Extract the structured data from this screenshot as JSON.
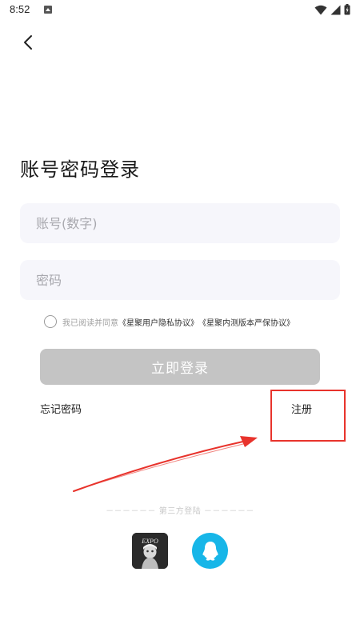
{
  "status_bar": {
    "time": "8:52",
    "icons": [
      "notification-app-icon",
      "wifi-icon",
      "cell-signal-icon",
      "battery-icon"
    ]
  },
  "header": {
    "back_icon": "chevron-left-icon"
  },
  "title": "账号密码登录",
  "form": {
    "account_placeholder": "账号(数字)",
    "account_value": "",
    "password_placeholder": "密码",
    "password_value": ""
  },
  "agreement": {
    "checked": false,
    "prefix": "我已阅读并同意",
    "privacy_link": "《星聚用户隐私协议》",
    "beta_link": "《星聚内测版本严保协议》"
  },
  "login_button": "立即登录",
  "forgot_password": "忘记密码",
  "register": "注册",
  "third_party": {
    "divider_text": "－－－－－－ 第三方登陆 －－－－－－",
    "providers": [
      "app-avatar-icon",
      "qq-icon"
    ]
  },
  "annotation": {
    "color": "#e8332c"
  },
  "colors": {
    "input_bg": "#f6f6fb",
    "button_disabled": "#c4c4c4",
    "qq_blue": "#17b6e8"
  }
}
